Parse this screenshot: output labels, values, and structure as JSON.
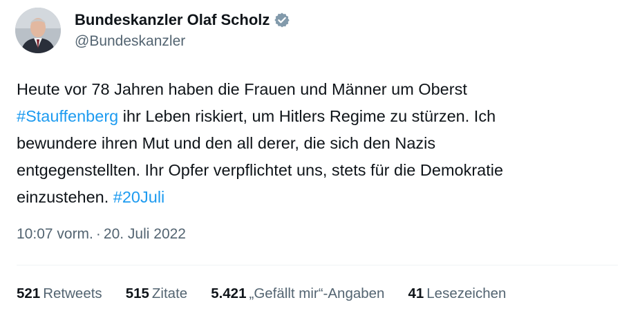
{
  "author": {
    "display_name": "Bundeskanzler Olaf Scholz",
    "handle": "@Bundeskanzler",
    "verified_icon": "verified-badge-icon",
    "verified_color": "#829aab"
  },
  "tweet": {
    "lines": [
      [
        {
          "text": "Heute vor 78 Jahren haben die Frauen und Männer um Oberst",
          "hashtag": false
        }
      ],
      [
        {
          "text": "#Stauffenberg",
          "hashtag": true
        },
        {
          "text": " ihr Leben riskiert, um Hitlers Regime zu stürzen. Ich",
          "hashtag": false
        }
      ],
      [
        {
          "text": "bewundere ihren Mut und den all derer, die sich den Nazis",
          "hashtag": false
        }
      ],
      [
        {
          "text": "entgegenstellten. Ihr Opfer verpflichtet uns, stets für die Demokratie",
          "hashtag": false
        }
      ],
      [
        {
          "text": "einzustehen. ",
          "hashtag": false
        },
        {
          "text": "#20Juli",
          "hashtag": true
        }
      ]
    ],
    "hashtag_color": "#1d9bf0"
  },
  "meta": {
    "time": "10:07 vorm.",
    "separator": "·",
    "date": "20. Juli 2022"
  },
  "stats": [
    {
      "count": "521",
      "label": "Retweets"
    },
    {
      "count": "515",
      "label": "Zitate"
    },
    {
      "count": "5.421",
      "label": "„Gefällt mir“-Angaben"
    },
    {
      "count": "41",
      "label": "Lesezeichen"
    }
  ]
}
